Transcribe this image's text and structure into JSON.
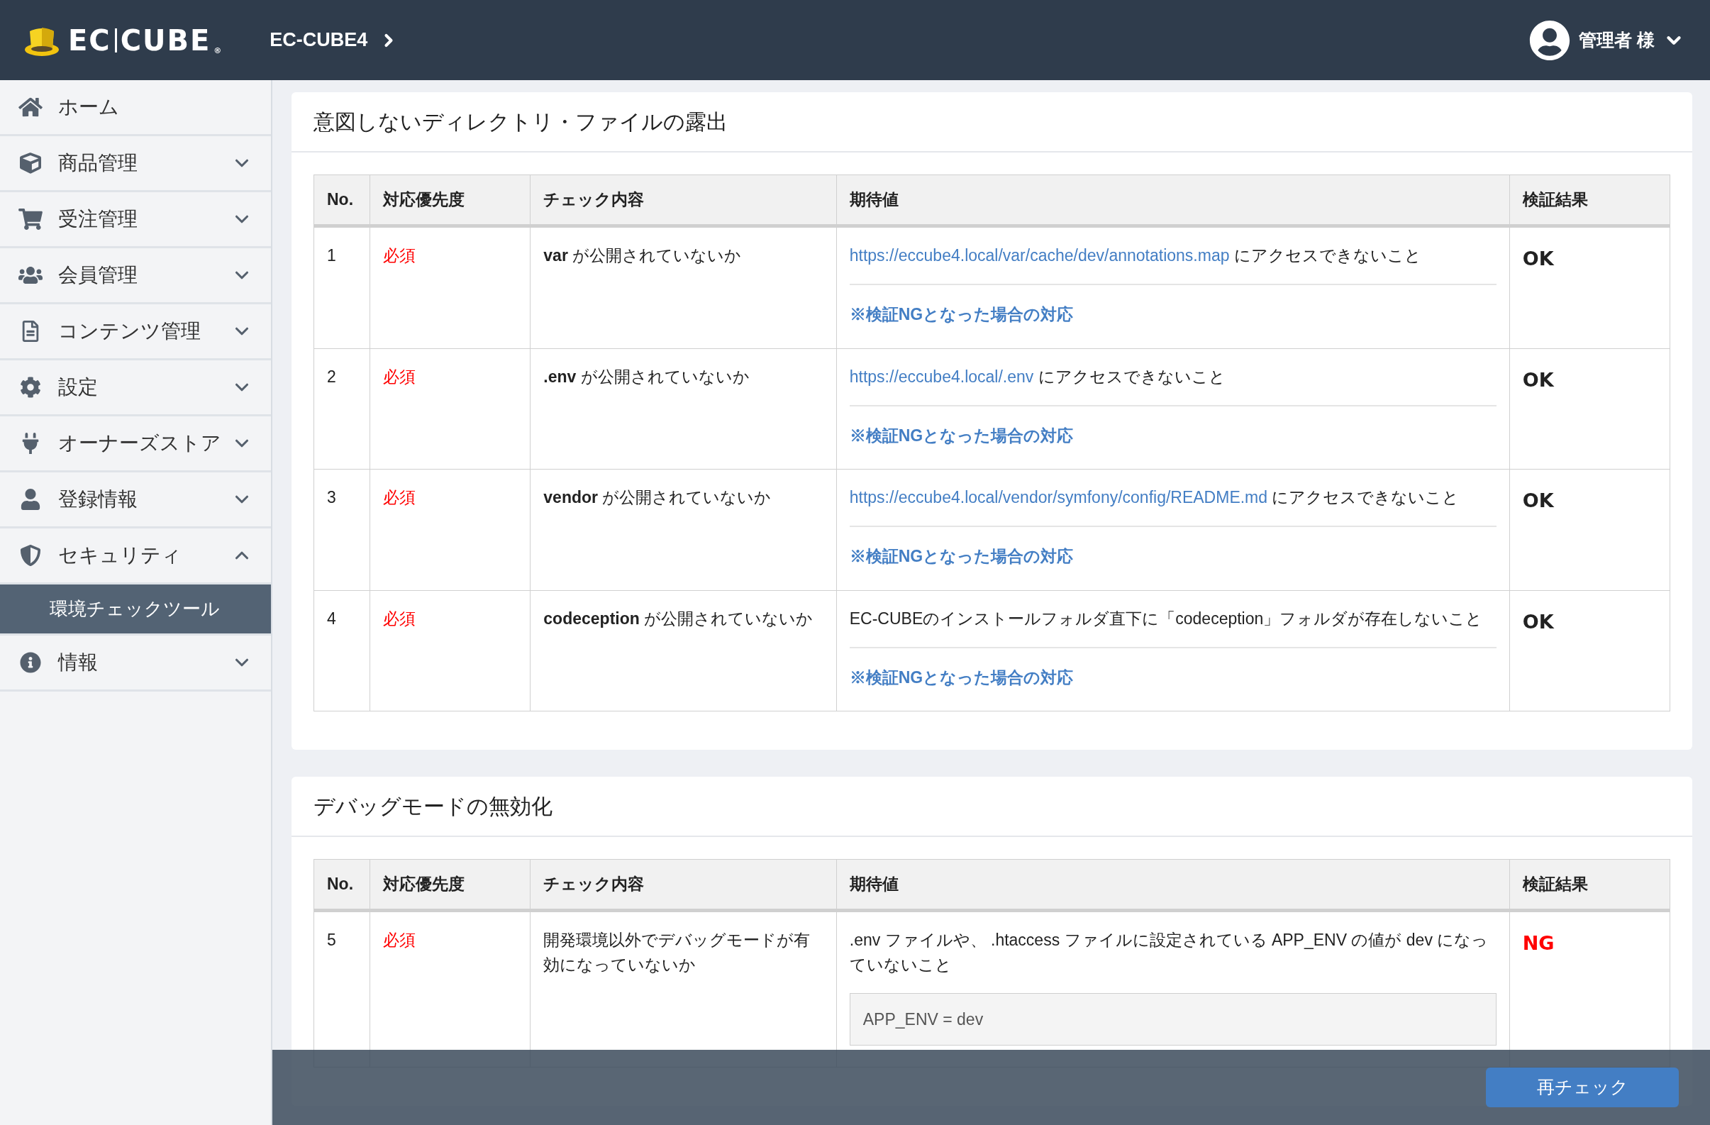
{
  "header": {
    "logo_parts": [
      "EC",
      "CUBE"
    ],
    "logo_mark": "®",
    "breadcrumb": "EC-CUBE4",
    "user": "管理者 様"
  },
  "sidebar": {
    "items": [
      {
        "label": "ホーム",
        "kind": "link"
      },
      {
        "label": "商品管理",
        "kind": "menu",
        "expanded": false
      },
      {
        "label": "受注管理",
        "kind": "menu",
        "expanded": false
      },
      {
        "label": "会員管理",
        "kind": "menu",
        "expanded": false
      },
      {
        "label": "コンテンツ管理",
        "kind": "menu",
        "expanded": false
      },
      {
        "label": "設定",
        "kind": "menu",
        "expanded": false
      },
      {
        "label": "オーナーズストア",
        "kind": "menu",
        "expanded": false
      },
      {
        "label": "登録情報",
        "kind": "menu",
        "expanded": false
      },
      {
        "label": "セキュリティ",
        "kind": "menu",
        "expanded": true,
        "children": [
          {
            "label": "環境チェックツール",
            "selected": true
          }
        ]
      },
      {
        "label": "情報",
        "kind": "menu",
        "expanded": false
      }
    ]
  },
  "sections": [
    {
      "title": "意図しないディレクトリ・ファイルの露出",
      "columns": [
        "No.",
        "対応優先度",
        "チェック内容",
        "期待値",
        "検証結果"
      ],
      "rows": [
        {
          "no": "1",
          "priority": "必須",
          "check": "**var** が公開されていないか",
          "expected": {
            "url": "https://eccube4.local/var/cache/dev/annotations.map",
            "text": " にアクセスできないこと"
          },
          "ng_link": "※検証NGとなった場合の対応",
          "result": "OK",
          "passed": true
        },
        {
          "no": "2",
          "priority": "必須",
          "check": "**.env** が公開されていないか",
          "expected": {
            "url": "https://eccube4.local/.env",
            "text": " にアクセスできないこと"
          },
          "ng_link": "※検証NGとなった場合の対応",
          "result": "OK",
          "passed": true
        },
        {
          "no": "3",
          "priority": "必須",
          "check": "**vendor** が公開されていないか",
          "expected": {
            "url": "https://eccube4.local/vendor/symfony/config/README.md",
            "text": " にアクセスできないこと"
          },
          "ng_link": "※検証NGとなった場合の対応",
          "result": "OK",
          "passed": true
        },
        {
          "no": "4",
          "priority": "必須",
          "check": "**codeception** が公開されていないか",
          "expected": {
            "text": "EC-CUBEのインストールフォルダ直下に「codeception」フォルダが存在しないこと"
          },
          "ng_link": "※検証NGとなった場合の対応",
          "result": "OK",
          "passed": true
        }
      ]
    },
    {
      "title": "デバッグモードの無効化",
      "columns": [
        "No.",
        "対応優先度",
        "チェック内容",
        "期待値",
        "検証結果"
      ],
      "rows": [
        {
          "no": "5",
          "priority": "必須",
          "check": "開発環境以外でデバッグモードが有効になっていないか",
          "expected": {
            "text": ".env ファイルや、 .htaccess ファイルに設定されている APP_ENV の値が dev になっていないこと",
            "code": "APP_ENV = dev"
          },
          "result": "NG",
          "passed": false
        }
      ]
    }
  ],
  "footer": {
    "button": "再チェック"
  }
}
